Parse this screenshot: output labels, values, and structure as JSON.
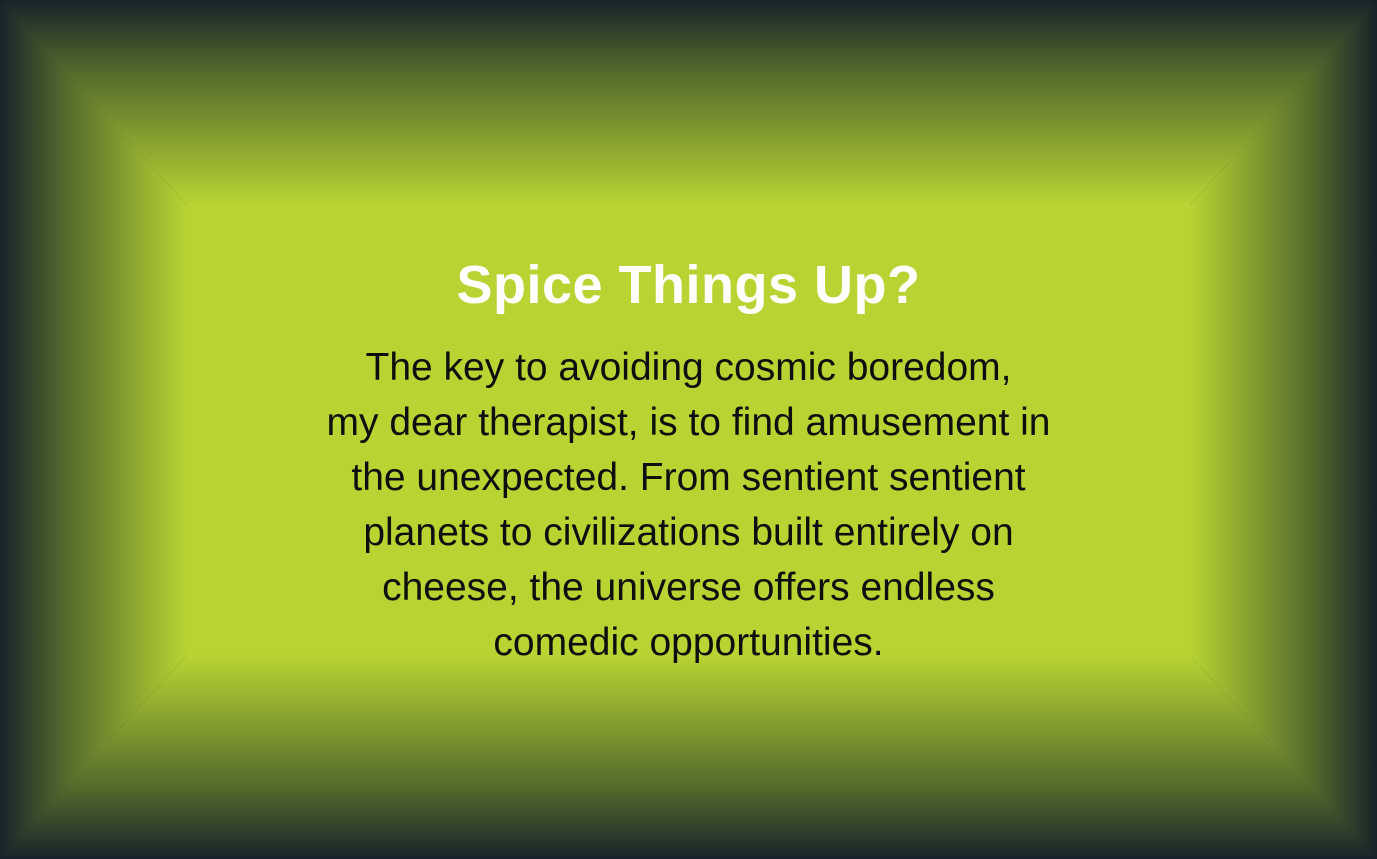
{
  "colors": {
    "panel_center": "#b8d432",
    "panel_edge": "#17232a",
    "title_text": "#ffffff",
    "body_text": "#0c0f0c"
  },
  "card": {
    "title": "Spice Things Up?",
    "body_lines": [
      "The key to avoiding cosmic boredom,",
      "my dear therapist, is to find amusement in",
      "the unexpected. From sentient sentient",
      "planets to civilizations built entirely on",
      "cheese, the universe offers endless",
      "comedic opportunities."
    ]
  }
}
